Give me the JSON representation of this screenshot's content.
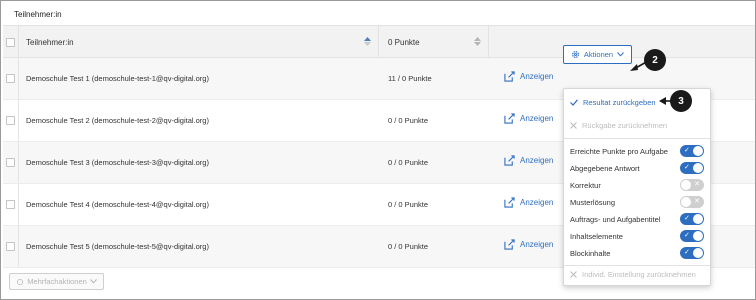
{
  "page": {
    "title": "Teilnehmer:in"
  },
  "table": {
    "headers": {
      "name": "Teilnehmer:in",
      "points": "0 Punkte"
    },
    "rows": [
      {
        "name": "Demoschule Test 1 (demoschule-test-1@qv-digital.org)",
        "points": "11 / 0 Punkte",
        "view_label": "Anzeigen"
      },
      {
        "name": "Demoschule Test 2 (demoschule-test-2@qv-digital.org)",
        "points": "0 / 0 Punkte",
        "view_label": "Anzeigen"
      },
      {
        "name": "Demoschule Test 3 (demoschule-test-3@qv-digital.org)",
        "points": "0 / 0 Punkte",
        "view_label": "Anzeigen"
      },
      {
        "name": "Demoschule Test 4 (demoschule-test-4@qv-digital.org)",
        "points": "0 / 0 Punkte",
        "view_label": "Anzeigen"
      },
      {
        "name": "Demoschule Test 5 (demoschule-test-5@qv-digital.org)",
        "points": "0 / 0 Punkte",
        "view_label": "Anzeigen"
      }
    ]
  },
  "actions": {
    "label": "Aktionen"
  },
  "bulk_actions": {
    "label": "Mehrfachaktionen"
  },
  "menu": {
    "result_back": "Resultat zurückgeben",
    "undo_return": "Rückgabe zurücknehmen",
    "toggles": [
      {
        "label": "Erreichte Punkte pro Aufgabe",
        "on": true
      },
      {
        "label": "Abgegebene Antwort",
        "on": true
      },
      {
        "label": "Korrektur",
        "on": false
      },
      {
        "label": "Musterlösung",
        "on": false
      },
      {
        "label": "Auftrags- und Aufgabentitel",
        "on": true
      },
      {
        "label": "Inhaltselemente",
        "on": true
      },
      {
        "label": "Blockinhalte",
        "on": true
      }
    ],
    "reset_individual": "Individ. Einstellung zurücknehmen"
  },
  "callouts": {
    "badge_2": "2",
    "badge_3": "3"
  },
  "colors": {
    "accent": "#2e6ec0",
    "callout": "#1a1a1a"
  }
}
